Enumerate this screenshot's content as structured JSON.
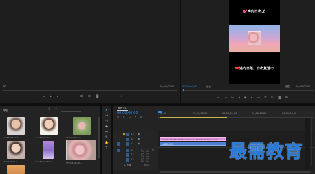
{
  "source_monitor": {
    "timecode_right": "00;00;00;00"
  },
  "program_monitor": {
    "timecode_left": "00;00;00;00",
    "fit_label": "适合",
    "quality_label": "完整",
    "timecode_right": "00;00;00;00",
    "phone_top_text": "💕奔向日出🌶",
    "phone_bottom_text": "❤️逃向日落，日出复活😊"
  },
  "project_panel": {
    "title": "项目",
    "items": [
      {
        "label": "1445526611cba...",
        "duration": "5:00"
      },
      {
        "label": "1e25a5fda8ae...",
        "duration": "5:00"
      },
      {
        "label": "1569e2fda4a5...",
        "duration": "5:00"
      },
      {
        "label": "1982bc3ae1c...",
        "duration": "5:00"
      },
      {
        "label": "ea123d5bb1f2aa...",
        "duration": "5:00"
      },
      {
        "label": "5f53d5b4ca6c...",
        "duration": "5:00"
      }
    ]
  },
  "timeline": {
    "sequence_tab": "序列 01",
    "timecode": "00;00;00;00",
    "ruler_labels": [
      "00;00",
      "00;00;16;00",
      "00;00;32;00",
      "00;00;48;00",
      "00;01;04;00"
    ],
    "tracks": [
      "V3",
      "V2",
      "V1",
      "A1",
      "A2",
      "A3"
    ],
    "master_label": "主声道",
    "master_value": "0.0",
    "clip_v2_label": "fx da73a4e4f53d5b4ca6c9ab4e54b7fa5e6c1a8c2.jpg",
    "clip_v1_label": "fx 颜色遮罩"
  },
  "watermark": "最需教育",
  "colors": {
    "accent": "#2d8ceb",
    "clip_pink": "#e08fd6",
    "clip_blue": "#4f7fd1",
    "work_area": "#c8b54a"
  }
}
